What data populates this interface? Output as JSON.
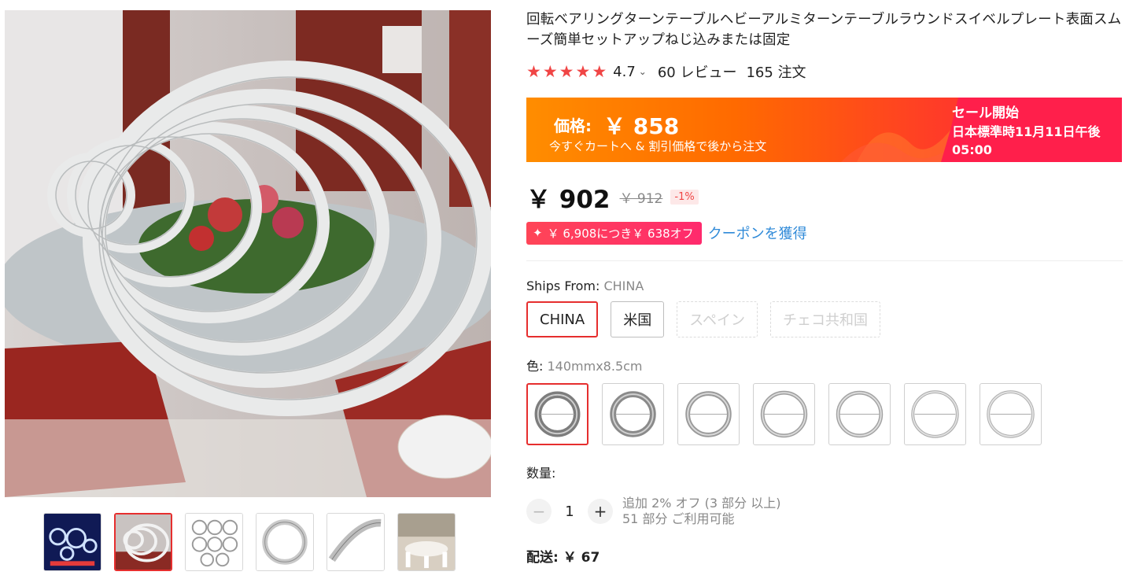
{
  "product": {
    "title": "回転ベアリングターンテーブルヘビーアルミターンテーブルラウンドスイベルプレート表面スムーズ簡単セットアップねじ込みまたは固定",
    "rating": "4.7",
    "rating_chevron": "⌄",
    "reviews": "60 レビュー",
    "orders": "165 注文",
    "stars": 5
  },
  "gallery": {
    "thumbnails": [
      "product-collage",
      "stacked-rings",
      "size-chart",
      "single-ring",
      "ring-detail",
      "dining-room"
    ],
    "active_index": 1
  },
  "promo": {
    "price_label": "価格:",
    "price_value": "￥ 858",
    "subtext": "今すぐカートへ & 割引価格で後から注文",
    "sale_title": "セール開始",
    "sale_date": "日本標準時11月11日午後05:00"
  },
  "price": {
    "current": "￥ 902",
    "original": "￥ 912",
    "discount": "-1%"
  },
  "coupon": {
    "icon": "✦",
    "text": "￥ 6,908につき￥ 638オフ",
    "link": "クーポンを獲得"
  },
  "shipping_from": {
    "label": "Ships From:",
    "value": "CHINA",
    "options": [
      "CHINA",
      "米国",
      "スペイン",
      "チェコ共和国"
    ]
  },
  "color": {
    "label": "色:",
    "value": "140mmx8.5cm",
    "swatch_count": 7
  },
  "quantity": {
    "label": "数量:",
    "minus": "−",
    "plus": "+",
    "value": "1",
    "info_line1": "追加 2% オフ (3 部分 以上)",
    "info_line2": "51 部分 ご利用可能"
  },
  "shipping": {
    "text": "配送: ￥ 67"
  },
  "colors": {
    "accent_red": "#e62e2e",
    "star_red": "#f04545",
    "link_blue": "#2f8ad8",
    "promo_orange": "#ff6a00",
    "promo_pink": "#ff1f4b"
  }
}
